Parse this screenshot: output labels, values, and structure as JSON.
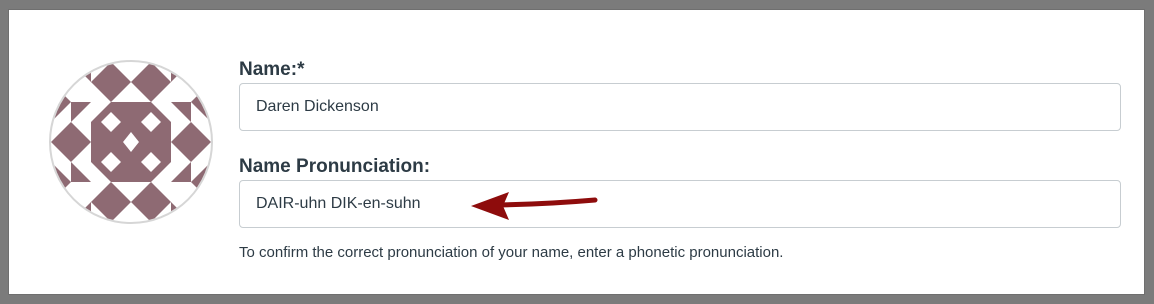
{
  "form": {
    "name_label": "Name:*",
    "name_value": "Daren Dickenson",
    "pronunciation_label": "Name Pronunciation:",
    "pronunciation_value": "DAIR-uhn DIK-en-suhn",
    "help_text": "To confirm the correct pronunciation of your name, enter a phonetic pronunciation."
  },
  "avatar": {
    "icon": "identicon-avatar",
    "pattern_color": "#8e6a73"
  },
  "annotation": {
    "icon": "red-arrow-icon",
    "color": "#8e0c0c"
  }
}
